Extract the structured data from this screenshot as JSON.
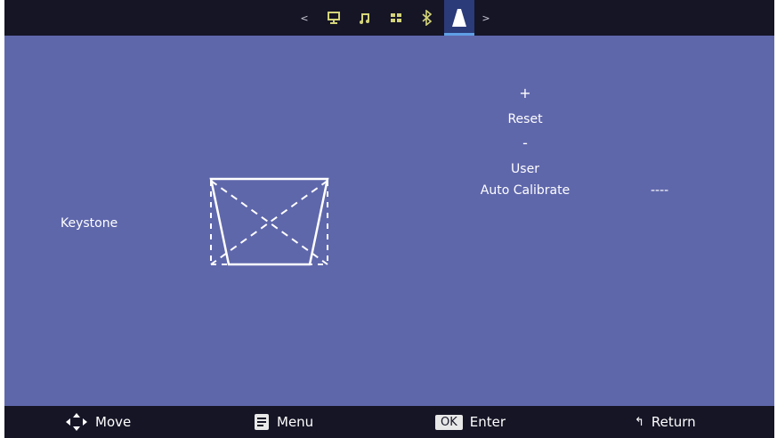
{
  "tabs": {
    "left_arrow": "<",
    "right_arrow": ">",
    "items": [
      {
        "icon": "display-icon"
      },
      {
        "icon": "music-icon"
      },
      {
        "icon": "apps-grid-icon"
      },
      {
        "icon": "bluetooth-icon"
      },
      {
        "icon": "projector-cone-icon",
        "active": true
      }
    ],
    "active_color": "#5f9fe6"
  },
  "settings": {
    "keystone_label": "Keystone",
    "plus": "+",
    "reset": "Reset",
    "minus": "-",
    "user": "User",
    "auto_calibrate_label": "Auto Calibrate",
    "auto_calibrate_value": "----"
  },
  "footer": {
    "move": "Move",
    "menu": "Menu",
    "ok_key": "OK",
    "enter": "Enter",
    "return_arrow": "↰",
    "return": "Return"
  },
  "colors": {
    "background": "#5f67ab",
    "bars": "#151526"
  }
}
